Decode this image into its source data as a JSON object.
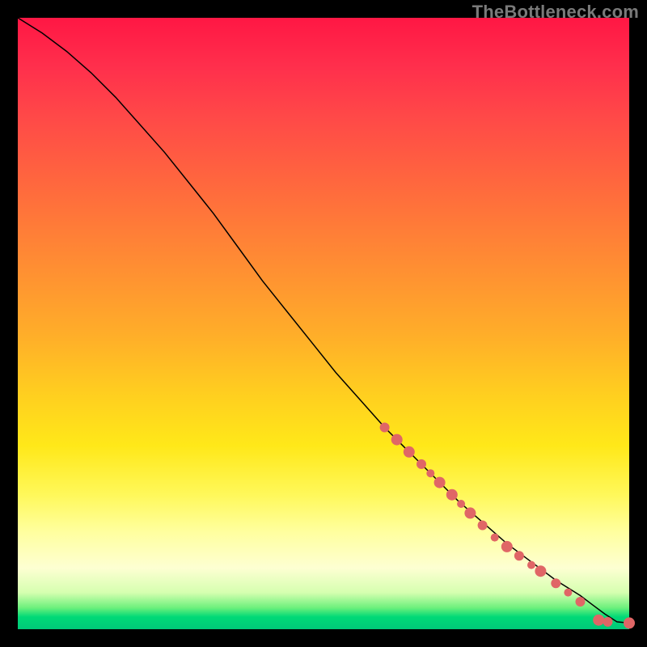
{
  "watermark": "TheBottleneck.com",
  "chart_data": {
    "type": "line",
    "title": "",
    "xlabel": "",
    "ylabel": "",
    "xlim": [
      0,
      100
    ],
    "ylim": [
      0,
      100
    ],
    "series": [
      {
        "name": "curve",
        "x": [
          0,
          4,
          8,
          12,
          16,
          20,
          24,
          28,
          32,
          36,
          40,
          44,
          48,
          52,
          56,
          60,
          64,
          68,
          72,
          76,
          80,
          84,
          88,
          92,
          94,
          96,
          98,
          100
        ],
        "y": [
          100,
          97.5,
          94.5,
          91,
          87,
          82.5,
          78,
          73,
          68,
          62.5,
          57,
          52,
          47,
          42,
          37.5,
          33,
          29,
          25,
          21,
          17.5,
          14,
          11,
          8,
          5.5,
          4,
          2.5,
          1.2,
          1.0
        ]
      }
    ],
    "markers": {
      "comment": "clustered dots along the lower-right tail of the curve",
      "points": [
        {
          "x": 60,
          "y": 33,
          "r": 6
        },
        {
          "x": 62,
          "y": 31,
          "r": 7
        },
        {
          "x": 64,
          "y": 29,
          "r": 7
        },
        {
          "x": 66,
          "y": 27,
          "r": 6
        },
        {
          "x": 67.5,
          "y": 25.5,
          "r": 5
        },
        {
          "x": 69,
          "y": 24,
          "r": 7
        },
        {
          "x": 71,
          "y": 22,
          "r": 7
        },
        {
          "x": 72.5,
          "y": 20.5,
          "r": 5
        },
        {
          "x": 74,
          "y": 19,
          "r": 7
        },
        {
          "x": 76,
          "y": 17,
          "r": 6
        },
        {
          "x": 78,
          "y": 15,
          "r": 5
        },
        {
          "x": 80,
          "y": 13.5,
          "r": 7
        },
        {
          "x": 82,
          "y": 12,
          "r": 6
        },
        {
          "x": 84,
          "y": 10.5,
          "r": 5
        },
        {
          "x": 85.5,
          "y": 9.5,
          "r": 7
        },
        {
          "x": 88,
          "y": 7.5,
          "r": 6
        },
        {
          "x": 90,
          "y": 6,
          "r": 5
        },
        {
          "x": 92,
          "y": 4.5,
          "r": 6
        },
        {
          "x": 95,
          "y": 1.5,
          "r": 7
        },
        {
          "x": 96.5,
          "y": 1.2,
          "r": 6
        },
        {
          "x": 100,
          "y": 1.0,
          "r": 7
        }
      ]
    }
  },
  "colors": {
    "marker": "#e06666",
    "curve": "#000000",
    "frame_bg": "#000000"
  }
}
